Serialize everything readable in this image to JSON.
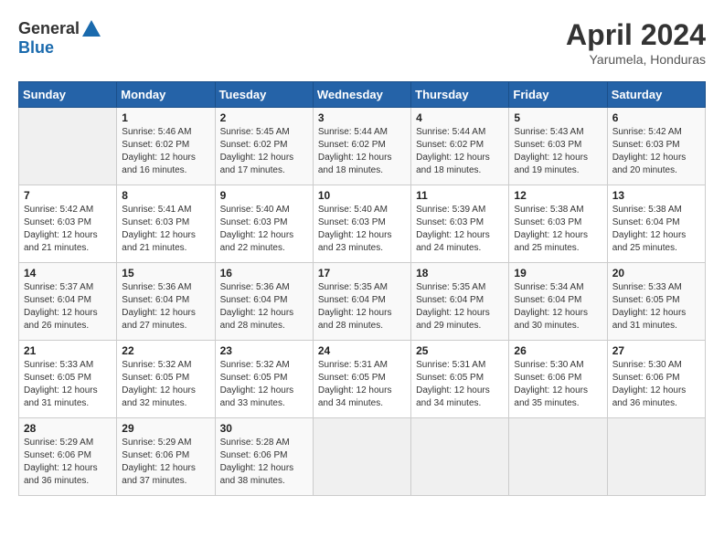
{
  "header": {
    "logo_general": "General",
    "logo_blue": "Blue",
    "title": "April 2024",
    "location": "Yarumela, Honduras"
  },
  "calendar": {
    "days_of_week": [
      "Sunday",
      "Monday",
      "Tuesday",
      "Wednesday",
      "Thursday",
      "Friday",
      "Saturday"
    ],
    "weeks": [
      [
        {
          "day": "",
          "info": ""
        },
        {
          "day": "1",
          "info": "Sunrise: 5:46 AM\nSunset: 6:02 PM\nDaylight: 12 hours\nand 16 minutes."
        },
        {
          "day": "2",
          "info": "Sunrise: 5:45 AM\nSunset: 6:02 PM\nDaylight: 12 hours\nand 17 minutes."
        },
        {
          "day": "3",
          "info": "Sunrise: 5:44 AM\nSunset: 6:02 PM\nDaylight: 12 hours\nand 18 minutes."
        },
        {
          "day": "4",
          "info": "Sunrise: 5:44 AM\nSunset: 6:02 PM\nDaylight: 12 hours\nand 18 minutes."
        },
        {
          "day": "5",
          "info": "Sunrise: 5:43 AM\nSunset: 6:03 PM\nDaylight: 12 hours\nand 19 minutes."
        },
        {
          "day": "6",
          "info": "Sunrise: 5:42 AM\nSunset: 6:03 PM\nDaylight: 12 hours\nand 20 minutes."
        }
      ],
      [
        {
          "day": "7",
          "info": "Sunrise: 5:42 AM\nSunset: 6:03 PM\nDaylight: 12 hours\nand 21 minutes."
        },
        {
          "day": "8",
          "info": "Sunrise: 5:41 AM\nSunset: 6:03 PM\nDaylight: 12 hours\nand 21 minutes."
        },
        {
          "day": "9",
          "info": "Sunrise: 5:40 AM\nSunset: 6:03 PM\nDaylight: 12 hours\nand 22 minutes."
        },
        {
          "day": "10",
          "info": "Sunrise: 5:40 AM\nSunset: 6:03 PM\nDaylight: 12 hours\nand 23 minutes."
        },
        {
          "day": "11",
          "info": "Sunrise: 5:39 AM\nSunset: 6:03 PM\nDaylight: 12 hours\nand 24 minutes."
        },
        {
          "day": "12",
          "info": "Sunrise: 5:38 AM\nSunset: 6:03 PM\nDaylight: 12 hours\nand 25 minutes."
        },
        {
          "day": "13",
          "info": "Sunrise: 5:38 AM\nSunset: 6:04 PM\nDaylight: 12 hours\nand 25 minutes."
        }
      ],
      [
        {
          "day": "14",
          "info": "Sunrise: 5:37 AM\nSunset: 6:04 PM\nDaylight: 12 hours\nand 26 minutes."
        },
        {
          "day": "15",
          "info": "Sunrise: 5:36 AM\nSunset: 6:04 PM\nDaylight: 12 hours\nand 27 minutes."
        },
        {
          "day": "16",
          "info": "Sunrise: 5:36 AM\nSunset: 6:04 PM\nDaylight: 12 hours\nand 28 minutes."
        },
        {
          "day": "17",
          "info": "Sunrise: 5:35 AM\nSunset: 6:04 PM\nDaylight: 12 hours\nand 28 minutes."
        },
        {
          "day": "18",
          "info": "Sunrise: 5:35 AM\nSunset: 6:04 PM\nDaylight: 12 hours\nand 29 minutes."
        },
        {
          "day": "19",
          "info": "Sunrise: 5:34 AM\nSunset: 6:04 PM\nDaylight: 12 hours\nand 30 minutes."
        },
        {
          "day": "20",
          "info": "Sunrise: 5:33 AM\nSunset: 6:05 PM\nDaylight: 12 hours\nand 31 minutes."
        }
      ],
      [
        {
          "day": "21",
          "info": "Sunrise: 5:33 AM\nSunset: 6:05 PM\nDaylight: 12 hours\nand 31 minutes."
        },
        {
          "day": "22",
          "info": "Sunrise: 5:32 AM\nSunset: 6:05 PM\nDaylight: 12 hours\nand 32 minutes."
        },
        {
          "day": "23",
          "info": "Sunrise: 5:32 AM\nSunset: 6:05 PM\nDaylight: 12 hours\nand 33 minutes."
        },
        {
          "day": "24",
          "info": "Sunrise: 5:31 AM\nSunset: 6:05 PM\nDaylight: 12 hours\nand 34 minutes."
        },
        {
          "day": "25",
          "info": "Sunrise: 5:31 AM\nSunset: 6:05 PM\nDaylight: 12 hours\nand 34 minutes."
        },
        {
          "day": "26",
          "info": "Sunrise: 5:30 AM\nSunset: 6:06 PM\nDaylight: 12 hours\nand 35 minutes."
        },
        {
          "day": "27",
          "info": "Sunrise: 5:30 AM\nSunset: 6:06 PM\nDaylight: 12 hours\nand 36 minutes."
        }
      ],
      [
        {
          "day": "28",
          "info": "Sunrise: 5:29 AM\nSunset: 6:06 PM\nDaylight: 12 hours\nand 36 minutes."
        },
        {
          "day": "29",
          "info": "Sunrise: 5:29 AM\nSunset: 6:06 PM\nDaylight: 12 hours\nand 37 minutes."
        },
        {
          "day": "30",
          "info": "Sunrise: 5:28 AM\nSunset: 6:06 PM\nDaylight: 12 hours\nand 38 minutes."
        },
        {
          "day": "",
          "info": ""
        },
        {
          "day": "",
          "info": ""
        },
        {
          "day": "",
          "info": ""
        },
        {
          "day": "",
          "info": ""
        }
      ]
    ]
  }
}
